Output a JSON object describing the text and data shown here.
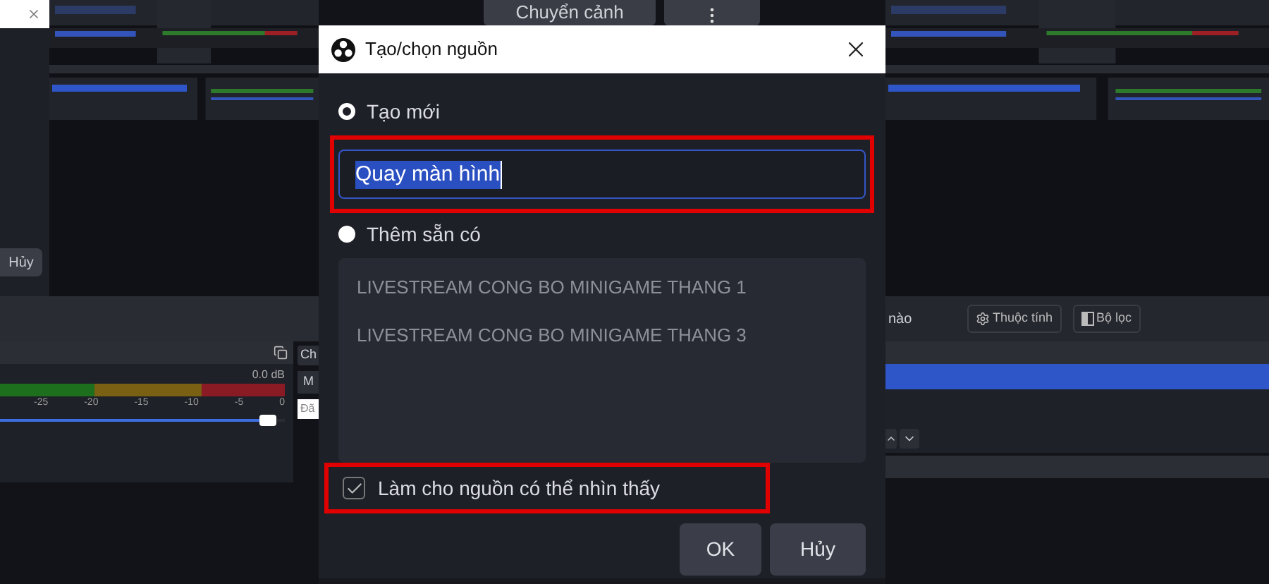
{
  "background": {
    "top_button": "Chuyển cảnh",
    "left_dialog_button": "Hủy",
    "mixer": {
      "reading": "0.0 dB",
      "ticks": [
        "-25",
        "-20",
        "-15",
        "-10",
        "-5",
        "0"
      ],
      "level": 0.97
    },
    "side_panel": {
      "title": "Ch",
      "button": "M",
      "field": "Đã"
    },
    "right_panel": {
      "label": "nào",
      "buttons": [
        "Thuộc tính",
        "Bộ lọc"
      ]
    }
  },
  "dialog": {
    "title": "Tạo/chọn nguồn",
    "options": [
      {
        "label": "Tạo mới",
        "selected": true
      },
      {
        "label": "Thêm sẵn có",
        "selected": false
      }
    ],
    "name_field": {
      "value": "Quay màn hình"
    },
    "existing_sources": [
      {
        "label": "LIVESTREAM CONG BO MINIGAME THANG 1"
      },
      {
        "label": "LIVESTREAM CONG BO MINIGAME THANG 3"
      }
    ],
    "visible_checkbox": {
      "label": "Làm cho nguồn có thể nhìn thấy",
      "checked": true
    },
    "buttons": [
      "OK",
      "Hủy"
    ]
  }
}
